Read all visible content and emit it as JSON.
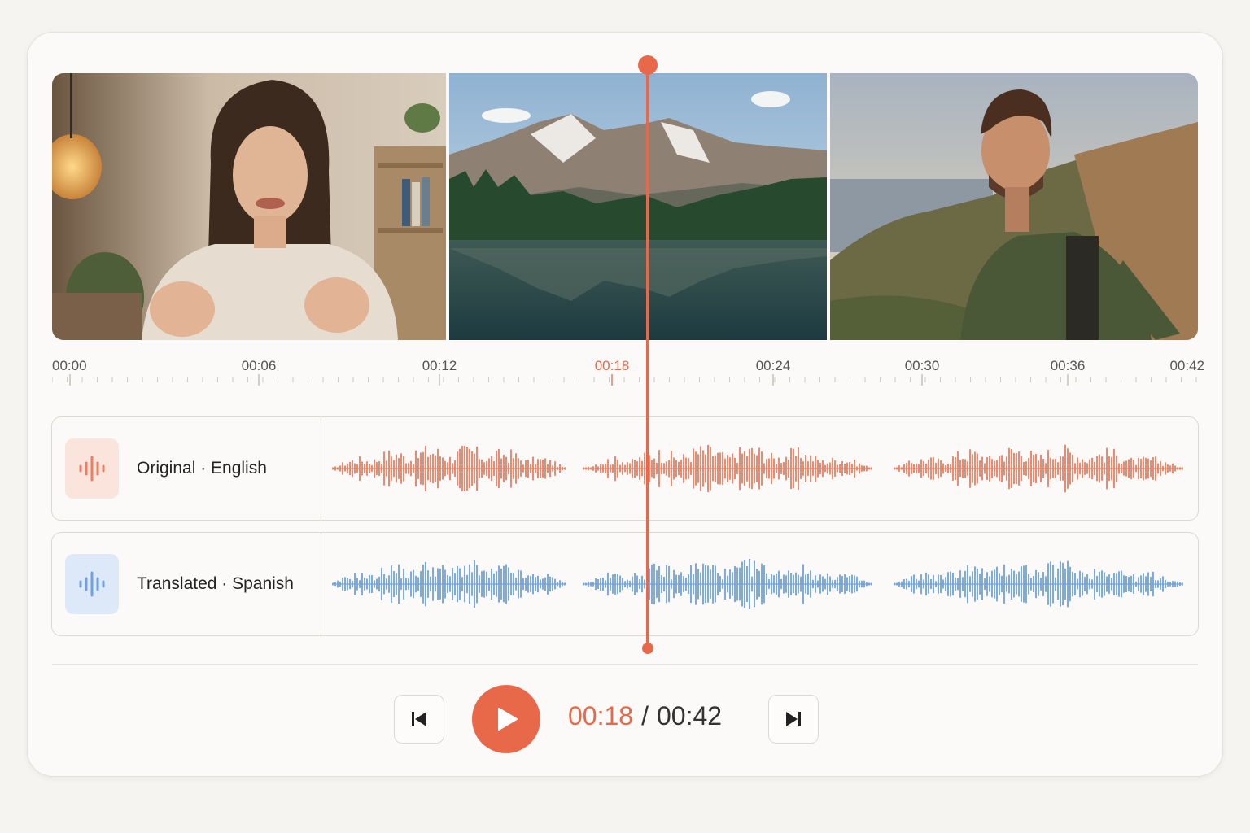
{
  "ruler": {
    "ticks": [
      "00:00",
      "00:06",
      "00:12",
      "00:18",
      "00:24",
      "00:30",
      "00:36",
      "00:42"
    ],
    "active": "00:18"
  },
  "tracks": {
    "original": {
      "label": "Original · English",
      "color": "#ee7c5f"
    },
    "translated": {
      "label": "Translated · Spanish",
      "color": "#6fa1e2"
    }
  },
  "player": {
    "current_time": "00:18",
    "separator": "/",
    "total_time": "00:42"
  },
  "icons": {
    "prev": "skip-previous-icon",
    "play": "play-icon",
    "next": "skip-next-icon",
    "track": "audio-waveform-icon"
  },
  "colors": {
    "accent": "#e8694a"
  }
}
